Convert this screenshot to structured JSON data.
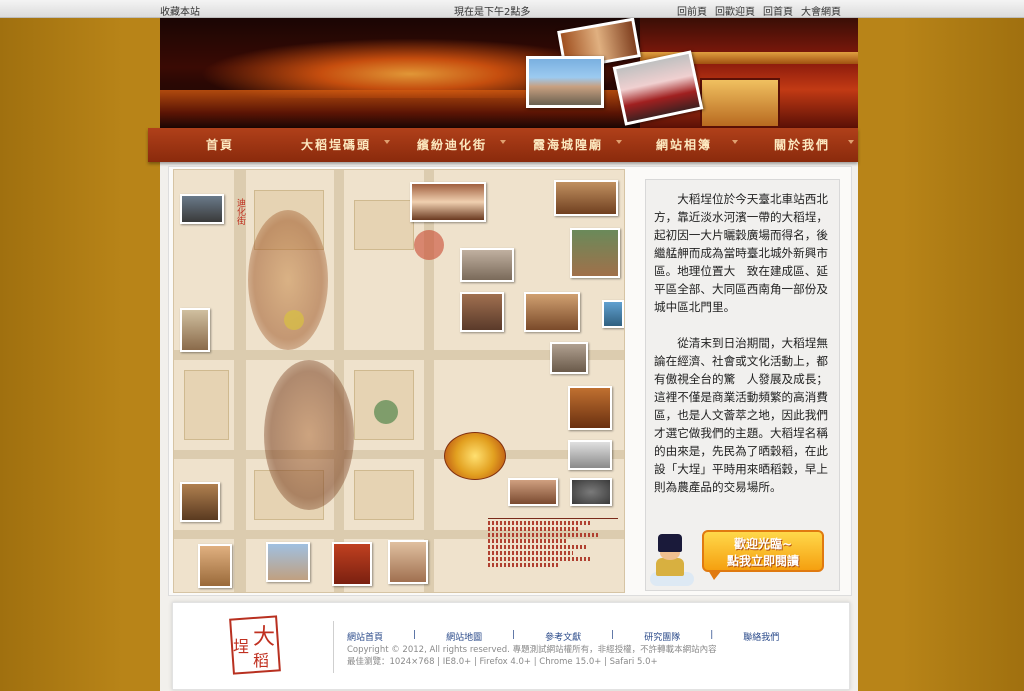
{
  "topbar": {
    "bookmark": "收藏本站",
    "time": "現在是下午2點多",
    "links": [
      "回前頁",
      "回歡迎頁",
      "回首頁",
      "大會網頁"
    ]
  },
  "nav": {
    "items": [
      "首頁",
      "大稻埕碼頭",
      "繽紛迪化街",
      "霞海城隍廟",
      "網站相簿",
      "關於我們"
    ]
  },
  "map": {
    "labels": [
      "迪化街"
    ]
  },
  "intro": {
    "p1": "大稻埕位於今天臺北車站西北方，靠近淡水河濱一帶的大稻埕，　起初因一大片曬穀廣場而得名，後繼艋舺而成為當時臺北城外新興市區。地理位置大　致在建成區、延平區全部、大同區西南角一部份及城中區北門里。",
    "p2": "從清末到日治期間，大稻埕無論在經濟、社會或文化活動上，都有傲視全台的驚　人發展及成長；這裡不僅是商業活動頻繁的高消費區，也是人文薈萃之地，因此我們才選它做我們的主題。大稻埕名稱的由來是，先民為了晒穀稻，在此設「大埕」平時用來晒稻穀，早上則為農產品的交易場所。"
  },
  "welcome": {
    "line1": "歡迎光臨~",
    "line2": "點我立即閱讀"
  },
  "footer": {
    "seal": [
      "大",
      "稻",
      "埕"
    ],
    "links": [
      "網站首頁",
      "網站地圖",
      "參考文獻",
      "研究團隊",
      "聯絡我們"
    ],
    "separator": "|",
    "copyright": "Copyright © 2012, All rights reserved. 專題測試網站權所有，非經授權，不許轉載本網站內容",
    "browsers": "最佳瀏覽：1024×768 | IE8.0+ | Firefox 4.0+ | Chrome 15.0+ | Safari 5.0+"
  }
}
